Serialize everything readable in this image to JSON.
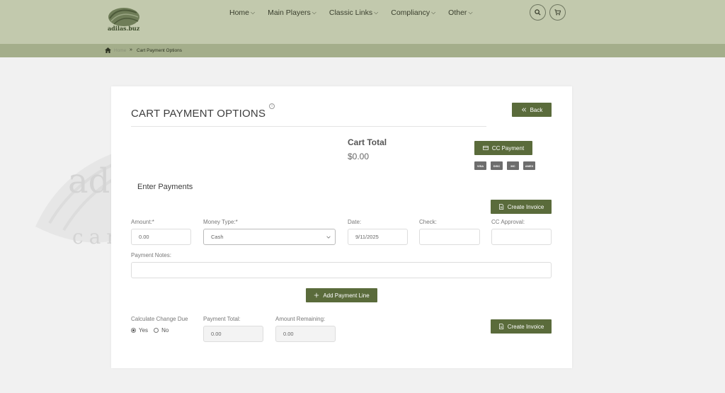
{
  "header": {
    "logo_text": "adilas.buz",
    "nav": [
      {
        "label": "Home"
      },
      {
        "label": "Main Players"
      },
      {
        "label": "Classic Links"
      },
      {
        "label": "Compliancy"
      },
      {
        "label": "Other"
      }
    ]
  },
  "breadcrumb": {
    "home": "Home",
    "current": "Cart Payment Options"
  },
  "watermark": {
    "line1": "ad",
    "line2": "car"
  },
  "page": {
    "title": "CART PAYMENT OPTIONS",
    "info_glyph": "i",
    "back_label": "Back",
    "cart_total_label": "Cart Total",
    "cart_total_value": "$0.00",
    "cc_payment_label": "CC Payment",
    "card_brands": [
      "VISA",
      "DISC",
      "MC",
      "AMEX"
    ],
    "section_title": "Enter Payments",
    "create_invoice_label": "Create Invoice",
    "add_payment_line_label": "Add Payment Line"
  },
  "form": {
    "amount_label": "Amount:*",
    "amount_value": "0.00",
    "money_type_label": "Money Type:*",
    "money_type_value": "Cash",
    "date_label": "Date:",
    "date_value": "9/11/2025",
    "check_label": "Check:",
    "check_value": "",
    "cc_approval_label": "CC Approval:",
    "cc_approval_value": "",
    "notes_label": "Payment Notes:",
    "notes_value": ""
  },
  "summary": {
    "calc_change_label": "Calculate Change Due",
    "yes_label": "Yes",
    "no_label": "No",
    "selected": "Yes",
    "payment_total_label": "Payment Total:",
    "payment_total_value": "0.00",
    "amount_remaining_label": "Amount Remaining:",
    "amount_remaining_value": "0.00"
  },
  "colors": {
    "header_bg": "#c2c9ad",
    "breadcrumb_bg": "#a4ae8b",
    "button_bg": "#5a6b3b"
  }
}
